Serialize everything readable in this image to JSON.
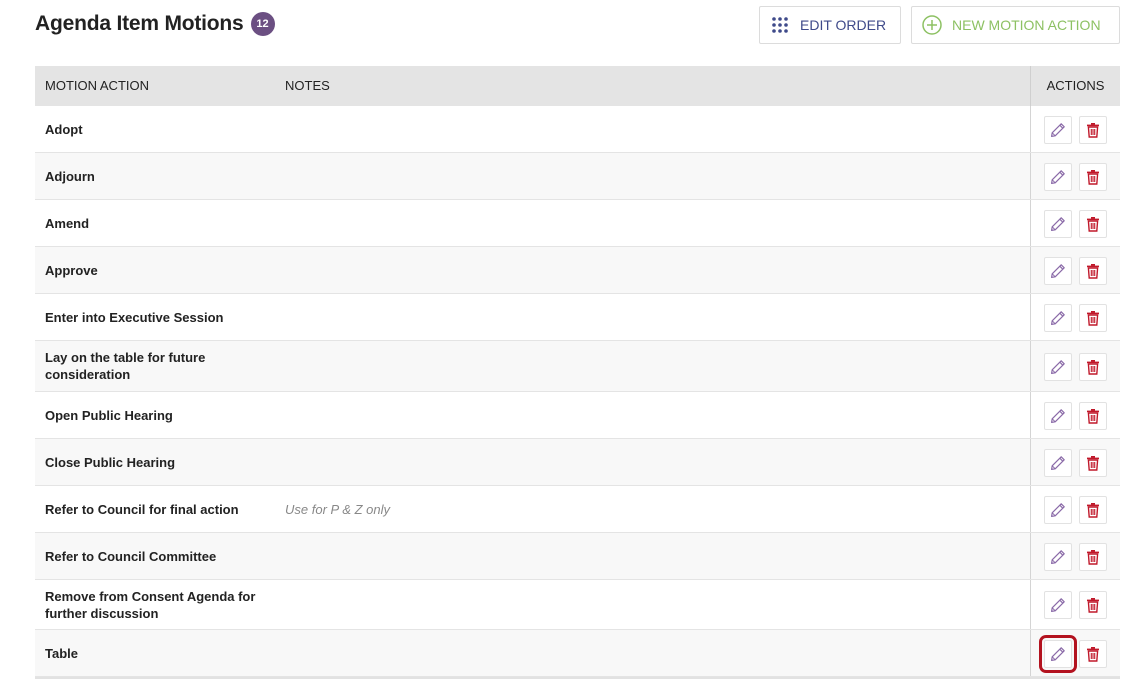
{
  "header": {
    "title": "Agenda Item Motions",
    "count": "12",
    "edit_order_label": "EDIT ORDER",
    "new_motion_label": "NEW MOTION ACTION"
  },
  "table": {
    "columns": {
      "motion_action": "MOTION ACTION",
      "notes": "NOTES",
      "actions": "ACTIONS"
    },
    "rows": [
      {
        "name": "Adopt",
        "notes": ""
      },
      {
        "name": "Adjourn",
        "notes": ""
      },
      {
        "name": "Amend",
        "notes": ""
      },
      {
        "name": "Approve",
        "notes": ""
      },
      {
        "name": "Enter into Executive Session",
        "notes": ""
      },
      {
        "name": "Lay on the table for future consideration",
        "notes": ""
      },
      {
        "name": "Open Public Hearing",
        "notes": ""
      },
      {
        "name": "Close Public Hearing",
        "notes": ""
      },
      {
        "name": "Refer to Council for final action",
        "notes": "Use for P & Z only"
      },
      {
        "name": "Refer to Council Committee",
        "notes": ""
      },
      {
        "name": "Remove from Consent Agenda for further discussion",
        "notes": ""
      },
      {
        "name": "Table",
        "notes": "",
        "edit_highlighted": true
      }
    ]
  },
  "icons": {
    "edit_order": "drag-grid-icon",
    "new_motion": "plus-circle-icon",
    "edit": "pencil-icon",
    "delete": "trash-icon"
  },
  "colors": {
    "badge": "#6b4f82",
    "edit_order_text": "#3f4a8a",
    "new_motion_text": "#8dc163",
    "pencil": "#8a6aa8",
    "trash": "#c0182a",
    "highlight": "#b3121f",
    "header_bg": "#e4e4e4"
  }
}
